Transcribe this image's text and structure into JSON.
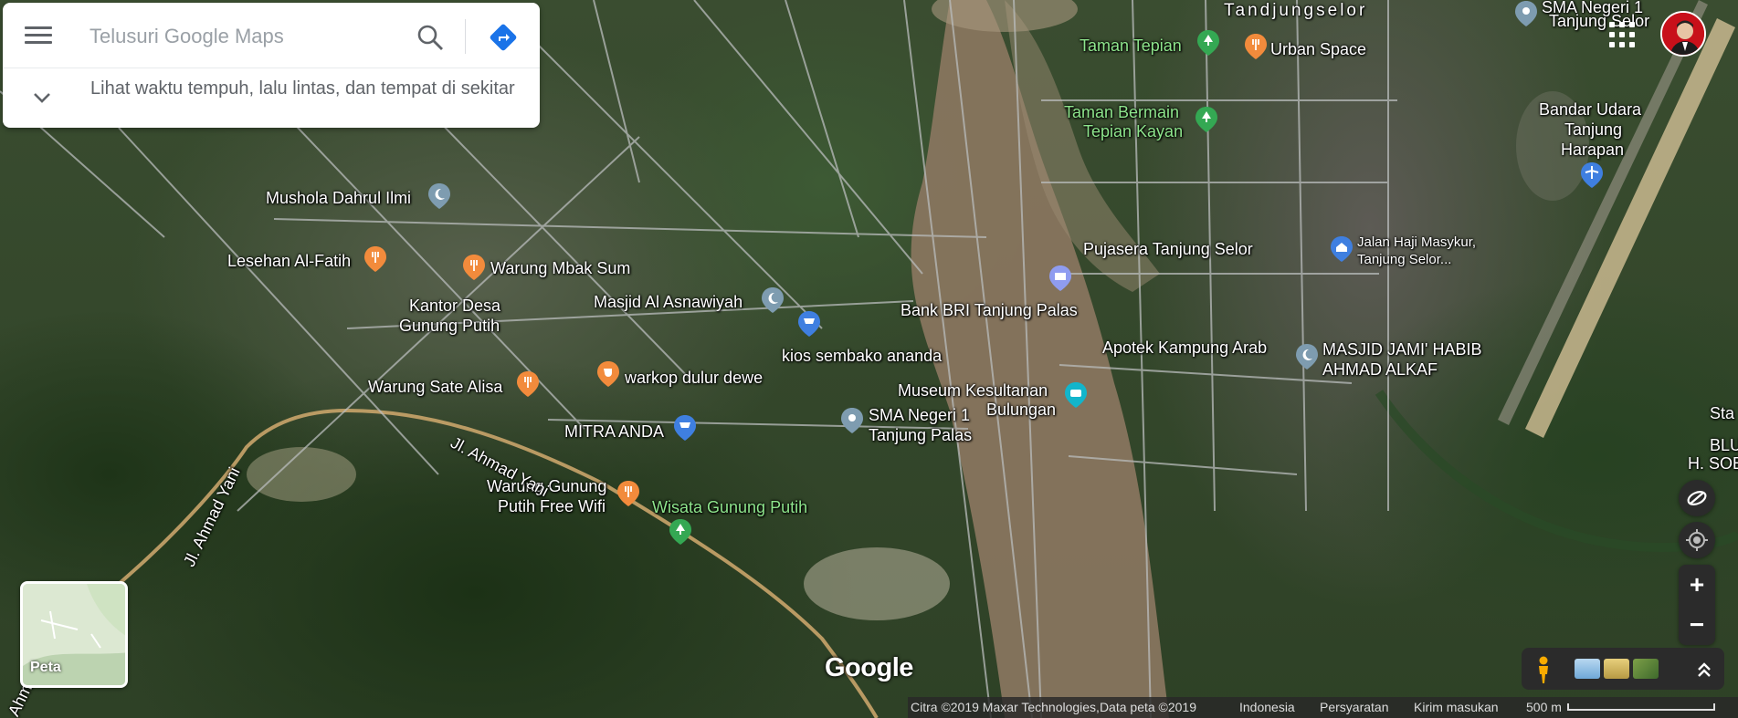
{
  "search": {
    "placeholder": "Telusuri Google Maps",
    "hint": "Lihat waktu tempuh, lalu lintas, dan tempat di sekitar"
  },
  "icons": {
    "menu": "hamburger-menu-icon",
    "search": "magnifier-icon",
    "directions": "directions-diamond-icon",
    "expand": "chevron-down-icon",
    "apps": "grid-apps-icon",
    "compass": "compass-icon",
    "locate": "my-location-icon",
    "pegman": "street-view-pegman-icon"
  },
  "places": {
    "mushola_dahrul_ilmi": "Mushola Dahrul Ilmi",
    "lesehan_al_fatih": "Lesehan Al-Fatih",
    "warung_mbak_sum": "Warung Mbak Sum",
    "kantor_desa_1": "Kantor Desa",
    "kantor_desa_2": "Gunung Putih",
    "masjid_al_asnawiyah": "Masjid Al Asnawiyah",
    "bank_bri": "Bank BRI Tanjung Palas",
    "kios_sembako": "kios sembako ananda",
    "warung_sate_alisa": "Warung Sate Alisa",
    "warkop": "warkop dulur dewe",
    "mitra_anda": "MITRA ANDA",
    "sma_1": "SMA Negeri 1",
    "sma_2": "Tanjung Palas",
    "museum_1": "Museum Kesultanan",
    "museum_2": "Bulungan",
    "warung_gunung_1": "Warung Gunung",
    "warung_gunung_2": "Putih Free Wifi",
    "wisata_gunung_putih": "Wisata Gunung Putih",
    "taman_tepian": "Taman Tepian",
    "urban_space": "Urban Space",
    "taman_bermain_1": "Taman Bermain",
    "taman_bermain_2": "Tepian Kayan",
    "pujasera": "Pujasera Tanjung Selor",
    "jalan_haji_1": "Jalan Haji Masykur,",
    "jalan_haji_2": "Tanjung Selor...",
    "apotek": "Apotek Kampung Arab",
    "masjid_jami_1": "MASJID JAMI' HABIB",
    "masjid_jami_2": "AHMAD ALKAF",
    "bandar_udara_1": "Bandar Udara",
    "bandar_udara_2": "Tanjung",
    "bandar_udara_3": "Harapan",
    "sma_negeri_top_1": "SMA Negeri 1",
    "sma_negeri_top_2": "Tanjung Selor",
    "tandjungselor": "Tandjungselor",
    "edge_sta": "Sta",
    "edge_blu": "BLU",
    "edge_hsob": "H. SOB",
    "road_ahmad_yani_1": "Jl. Ahmad Yani",
    "road_ahmad_yani_2": "Jl. Ahmad Yani",
    "road_ahmad_3": "Ahmad"
  },
  "minimap": {
    "label": "Peta"
  },
  "branding": {
    "logo": "Google"
  },
  "footer": {
    "attribution": "Citra ©2019 Maxar Technologies,Data peta ©2019",
    "region": "Indonesia",
    "terms": "Persyaratan",
    "feedback": "Kirim masukan",
    "scale": "500 m"
  },
  "colors": {
    "pin_food": "#f28b3c",
    "pin_worship": "#7e9cb0",
    "pin_shop": "#3f7fe0",
    "pin_park": "#34a853",
    "pin_museum": "#12b5cb",
    "pin_generic": "#8f9cf0",
    "river": "#8a7660"
  }
}
